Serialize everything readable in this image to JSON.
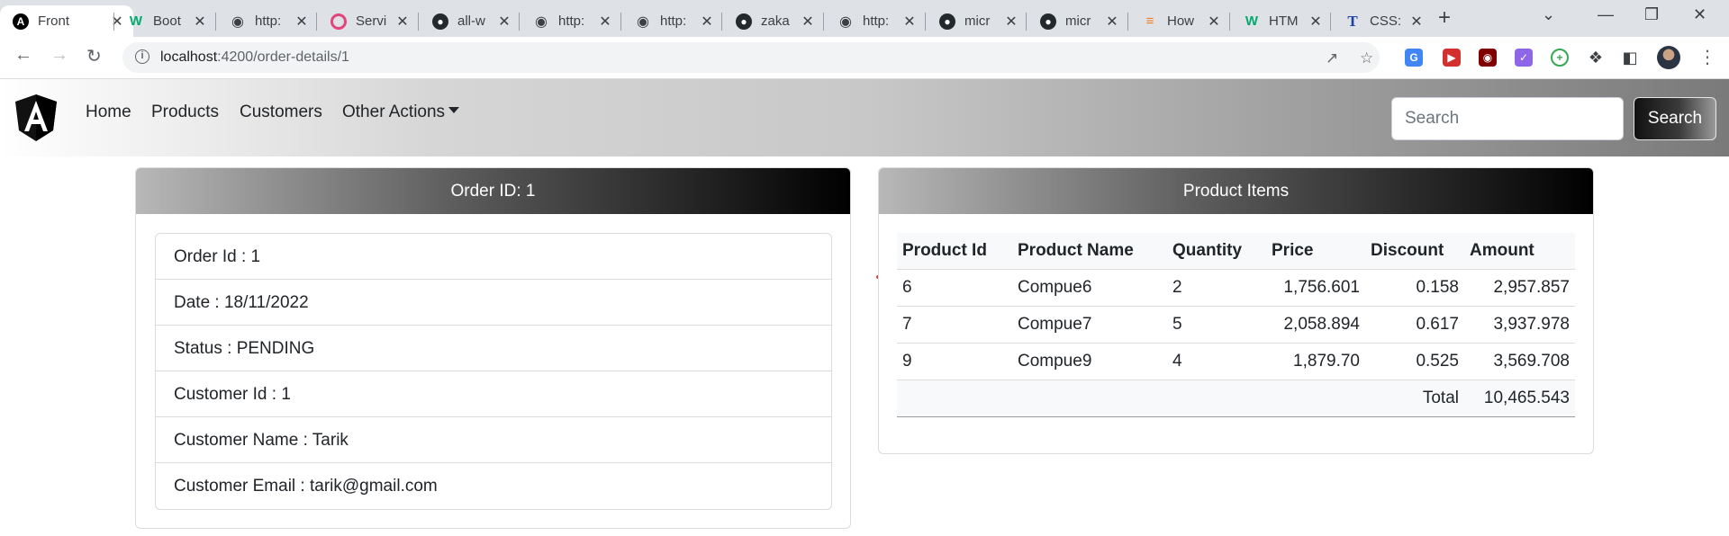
{
  "browser": {
    "tabs": [
      {
        "title": "Front",
        "icon": "angular-icon",
        "active": true
      },
      {
        "title": "Boot",
        "icon": "w3schools-icon"
      },
      {
        "title": "http:",
        "icon": "globe-icon"
      },
      {
        "title": "Servi",
        "icon": "circle-logo-icon"
      },
      {
        "title": "all-w",
        "icon": "github-icon"
      },
      {
        "title": "http:",
        "icon": "globe-icon"
      },
      {
        "title": "http:",
        "icon": "globe-icon"
      },
      {
        "title": "zaka",
        "icon": "github-icon"
      },
      {
        "title": "http:",
        "icon": "globe-icon"
      },
      {
        "title": "micr",
        "icon": "github-icon"
      },
      {
        "title": "micr",
        "icon": "github-icon"
      },
      {
        "title": "How",
        "icon": "stackoverflow-icon"
      },
      {
        "title": "HTM",
        "icon": "w3schools-icon"
      },
      {
        "title": "CSS:",
        "icon": "t-logo-icon"
      }
    ],
    "url_host": "localhost",
    "url_rest": ":4200/order-details/1"
  },
  "navbar": {
    "links": [
      "Home",
      "Products",
      "Customers"
    ],
    "dropdown_label": "Other Actions",
    "search_placeholder": "Search",
    "search_button": "Search"
  },
  "order": {
    "header": "Order ID: 1",
    "details": [
      "Order Id : 1",
      "Date : 18/11/2022",
      "Status : PENDING",
      "Customer Id : 1",
      "Customer Name : Tarik",
      "Customer Email : tarik@gmail.com"
    ]
  },
  "products": {
    "header": "Product Items",
    "columns": [
      "Product Id",
      "Product Name",
      "Quantity",
      "Price",
      "Discount",
      "Amount"
    ],
    "rows": [
      [
        "6",
        "Compue6",
        "2",
        "1,756.601",
        "0.158",
        "2,957.857"
      ],
      [
        "7",
        "Compue7",
        "5",
        "2,058.894",
        "0.617",
        "3,937.978"
      ],
      [
        "9",
        "Compue9",
        "4",
        "1,879.70",
        "0.525",
        "3,569.708"
      ]
    ],
    "total_label": "Total",
    "total_value": "10,465.543"
  }
}
